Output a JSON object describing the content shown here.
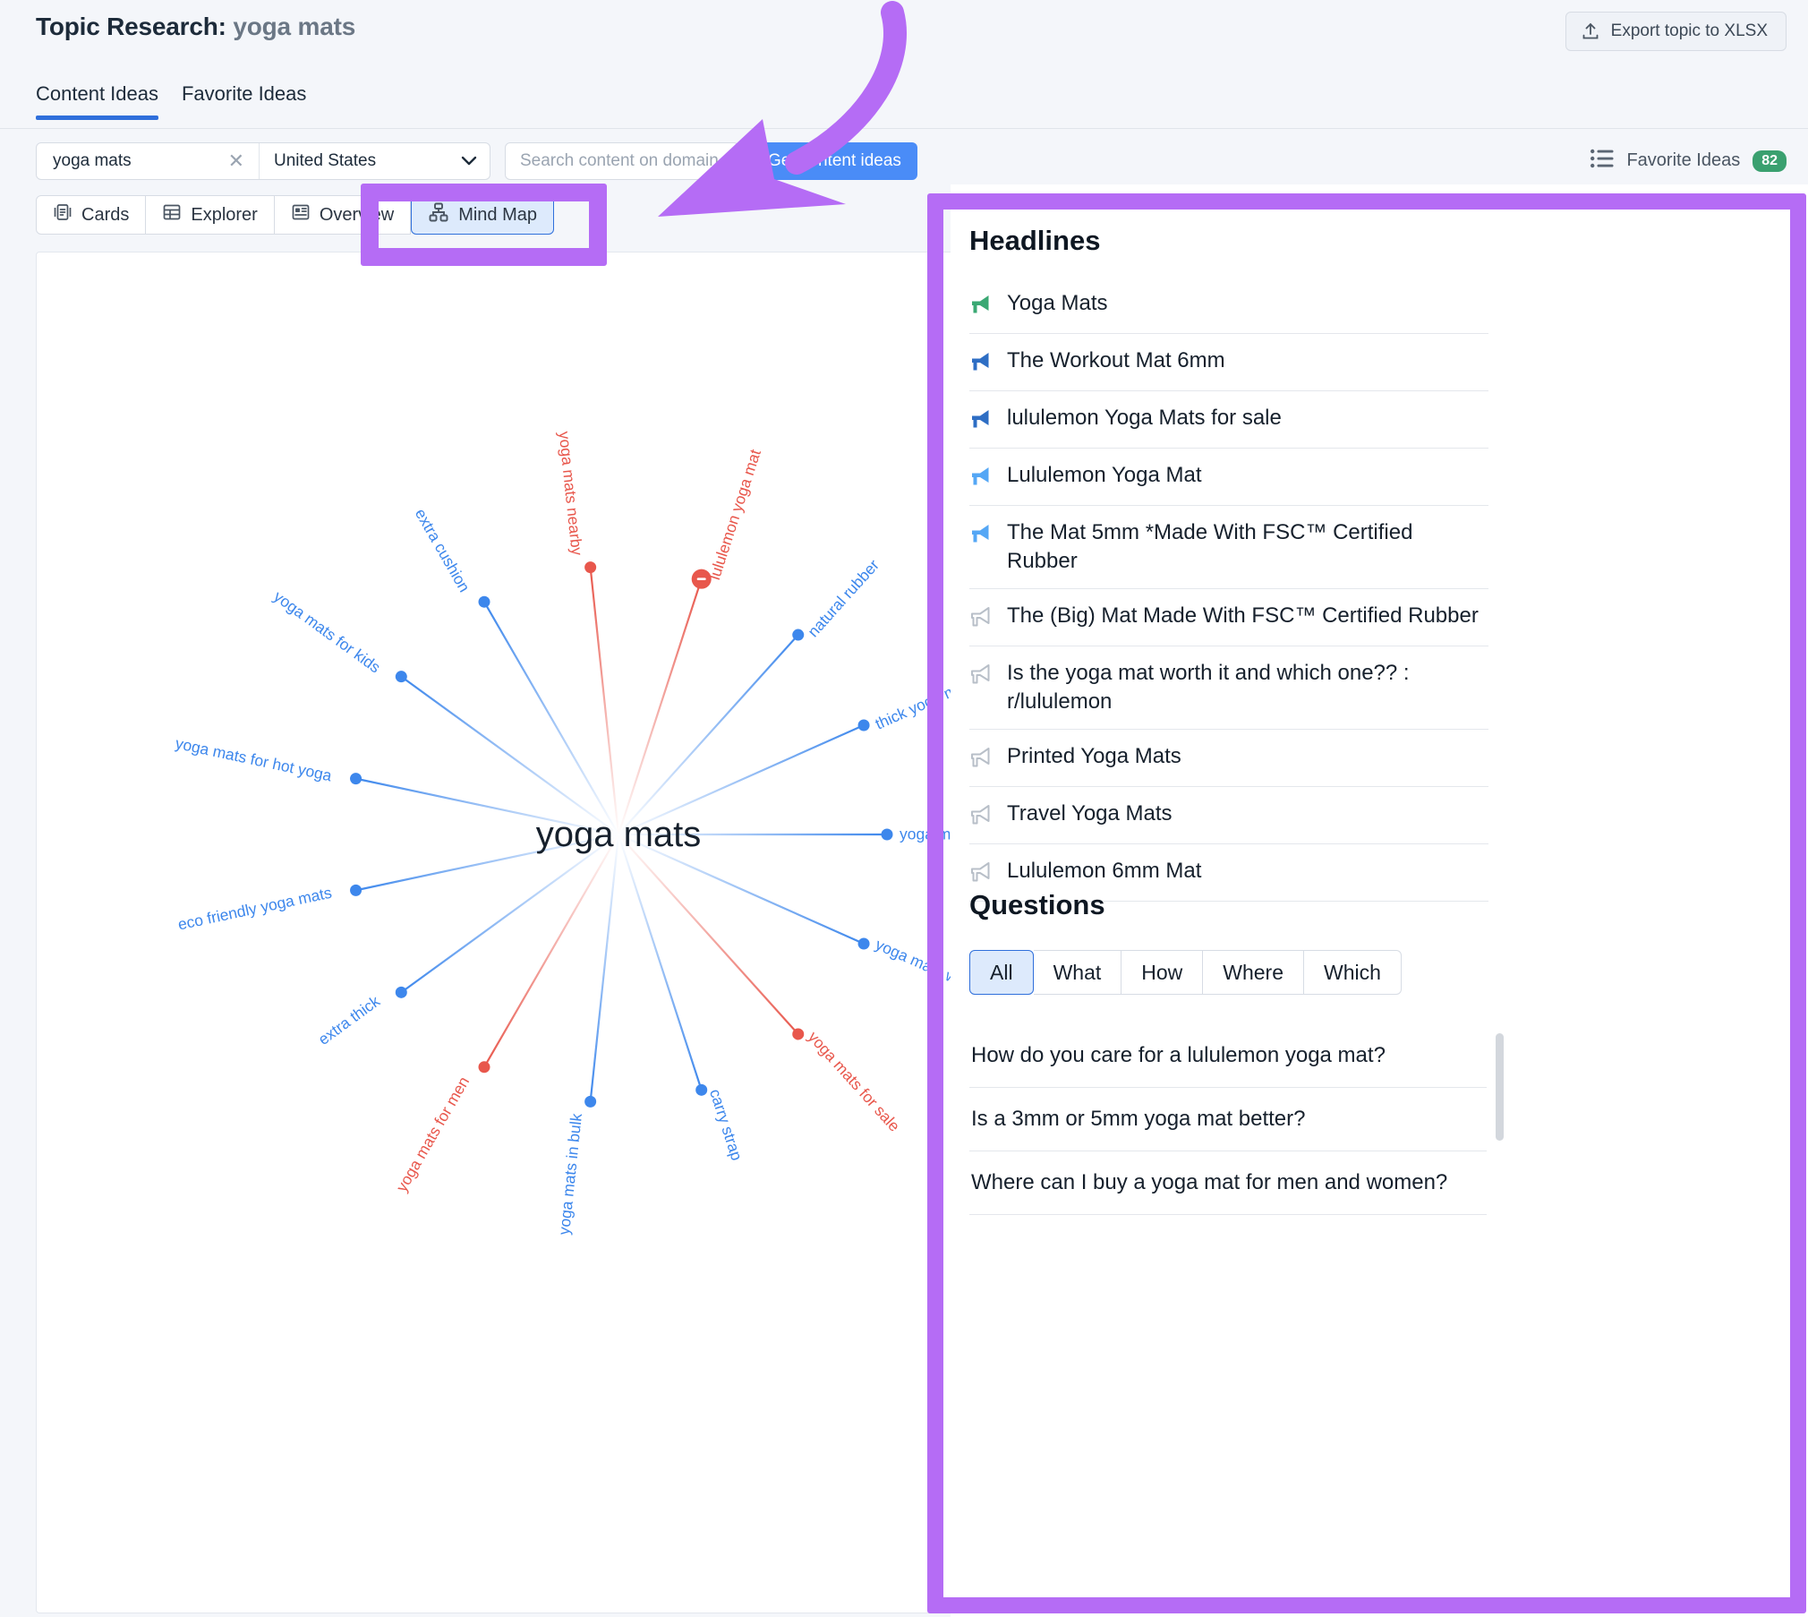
{
  "header": {
    "title_prefix": "Topic Research:",
    "title_keyword": "yoga mats",
    "export_label": "Export topic to XLSX",
    "export_icon": "upload-icon"
  },
  "tabs": [
    {
      "label": "Content Ideas",
      "active": true
    },
    {
      "label": "Favorite Ideas",
      "active": false
    }
  ],
  "search": {
    "keyword_value": "yoga mats",
    "clear_icon": "close-icon",
    "country_value": "United States",
    "chevron_icon": "chevron-down-icon",
    "domain_placeholder": "Search content on domain",
    "domain_value": "",
    "get_ideas_label": "Get content ideas"
  },
  "favorite_ideas": {
    "icon": "list-icon",
    "label": "Favorite Ideas",
    "count": "82"
  },
  "views": [
    {
      "label": "Cards",
      "icon": "cards-icon",
      "active": false
    },
    {
      "label": "Explorer",
      "icon": "table-icon",
      "active": false
    },
    {
      "label": "Overview",
      "icon": "overview-icon",
      "active": false
    },
    {
      "label": "Mind Map",
      "icon": "mindmap-icon",
      "active": true
    }
  ],
  "chart_data": {
    "type": "mindmap",
    "title": "yoga mats",
    "center": "yoga mats",
    "grid": false,
    "legend": "none",
    "xlabel": "",
    "ylabel": "",
    "nodes": [
      {
        "label": "lululemon yoga mat",
        "angle": -72,
        "radius": 300,
        "color": "#e8574c",
        "size": "large"
      },
      {
        "label": "natural rubber",
        "angle": -48,
        "radius": 300,
        "color": "#3d87ec",
        "size": "small"
      },
      {
        "label": "thick yoga mats",
        "angle": -24,
        "radius": 300,
        "color": "#3d87ec",
        "size": "small"
      },
      {
        "label": "yoga mats amazon",
        "angle": 0,
        "radius": 300,
        "color": "#3d87ec",
        "size": "small"
      },
      {
        "label": "yoga mats walmart",
        "angle": 24,
        "radius": 300,
        "color": "#3d87ec",
        "size": "small"
      },
      {
        "label": "yoga mats for sale",
        "angle": 48,
        "radius": 300,
        "color": "#e8574c",
        "size": "small"
      },
      {
        "label": "carry strap",
        "angle": 72,
        "radius": 300,
        "color": "#3d87ec",
        "size": "small"
      },
      {
        "label": "yoga mats in bulk",
        "angle": 96,
        "radius": 300,
        "color": "#3d87ec",
        "size": "small"
      },
      {
        "label": "yoga mats for men",
        "angle": 120,
        "radius": 300,
        "color": "#e8574c",
        "size": "small"
      },
      {
        "label": "extra thick",
        "angle": 144,
        "radius": 300,
        "color": "#3d87ec",
        "size": "small"
      },
      {
        "label": "eco friendly yoga mats",
        "angle": 168,
        "radius": 300,
        "color": "#3d87ec",
        "size": "small"
      },
      {
        "label": "yoga mats for hot yoga",
        "angle": 192,
        "radius": 300,
        "color": "#3d87ec",
        "size": "small"
      },
      {
        "label": "yoga mats for kids",
        "angle": 216,
        "radius": 300,
        "color": "#3d87ec",
        "size": "small"
      },
      {
        "label": "extra cushion",
        "angle": 240,
        "radius": 300,
        "color": "#3d87ec",
        "size": "small"
      },
      {
        "label": "yoga mats nearby",
        "angle": 264,
        "radius": 300,
        "color": "#e8574c",
        "size": "small"
      }
    ],
    "colors": {
      "blue": "#3d87ec",
      "red": "#e8574c"
    }
  },
  "panel": {
    "headlines_title": "Headlines",
    "headlines": [
      {
        "text": "Yoga Mats",
        "icon": "megaphone-icon",
        "color": "#3aa873"
      },
      {
        "text": "The Workout Mat 6mm",
        "icon": "megaphone-icon",
        "color": "#2e6ec4"
      },
      {
        "text": "lululemon Yoga Mats for sale",
        "icon": "megaphone-icon",
        "color": "#2e6ec4"
      },
      {
        "text": "Lululemon Yoga Mat",
        "icon": "megaphone-icon",
        "color": "#55a7f5"
      },
      {
        "text": "The Mat 5mm *Made With FSC™ Certified Rubber",
        "icon": "megaphone-icon",
        "color": "#55a7f5"
      },
      {
        "text": "The (Big) Mat Made With FSC™ Certified Rubber",
        "icon": "megaphone-outline-icon",
        "color": "#b8bfc8"
      },
      {
        "text": "Is the yoga mat worth it and which one?? : r/lululemon",
        "icon": "megaphone-outline-icon",
        "color": "#b8bfc8"
      },
      {
        "text": "Printed Yoga Mats",
        "icon": "megaphone-outline-icon",
        "color": "#b8bfc8"
      },
      {
        "text": "Travel Yoga Mats",
        "icon": "megaphone-outline-icon",
        "color": "#b8bfc8"
      },
      {
        "text": "Lululemon 6mm Mat",
        "icon": "megaphone-outline-icon",
        "color": "#b8bfc8"
      }
    ],
    "questions_title": "Questions",
    "question_tabs": [
      {
        "label": "All",
        "active": true
      },
      {
        "label": "What",
        "active": false
      },
      {
        "label": "How",
        "active": false
      },
      {
        "label": "Where",
        "active": false
      },
      {
        "label": "Which",
        "active": false
      }
    ],
    "questions": [
      "How do you care for a lululemon yoga mat?",
      "Is a 3mm or 5mm yoga mat better?",
      "Where can I buy a yoga mat for men and women?"
    ]
  },
  "annotations": {
    "highlight_color": "#b56cf5",
    "shapes": [
      "mindmap-button-highlight",
      "right-panel-highlight",
      "curved-arrow"
    ]
  }
}
